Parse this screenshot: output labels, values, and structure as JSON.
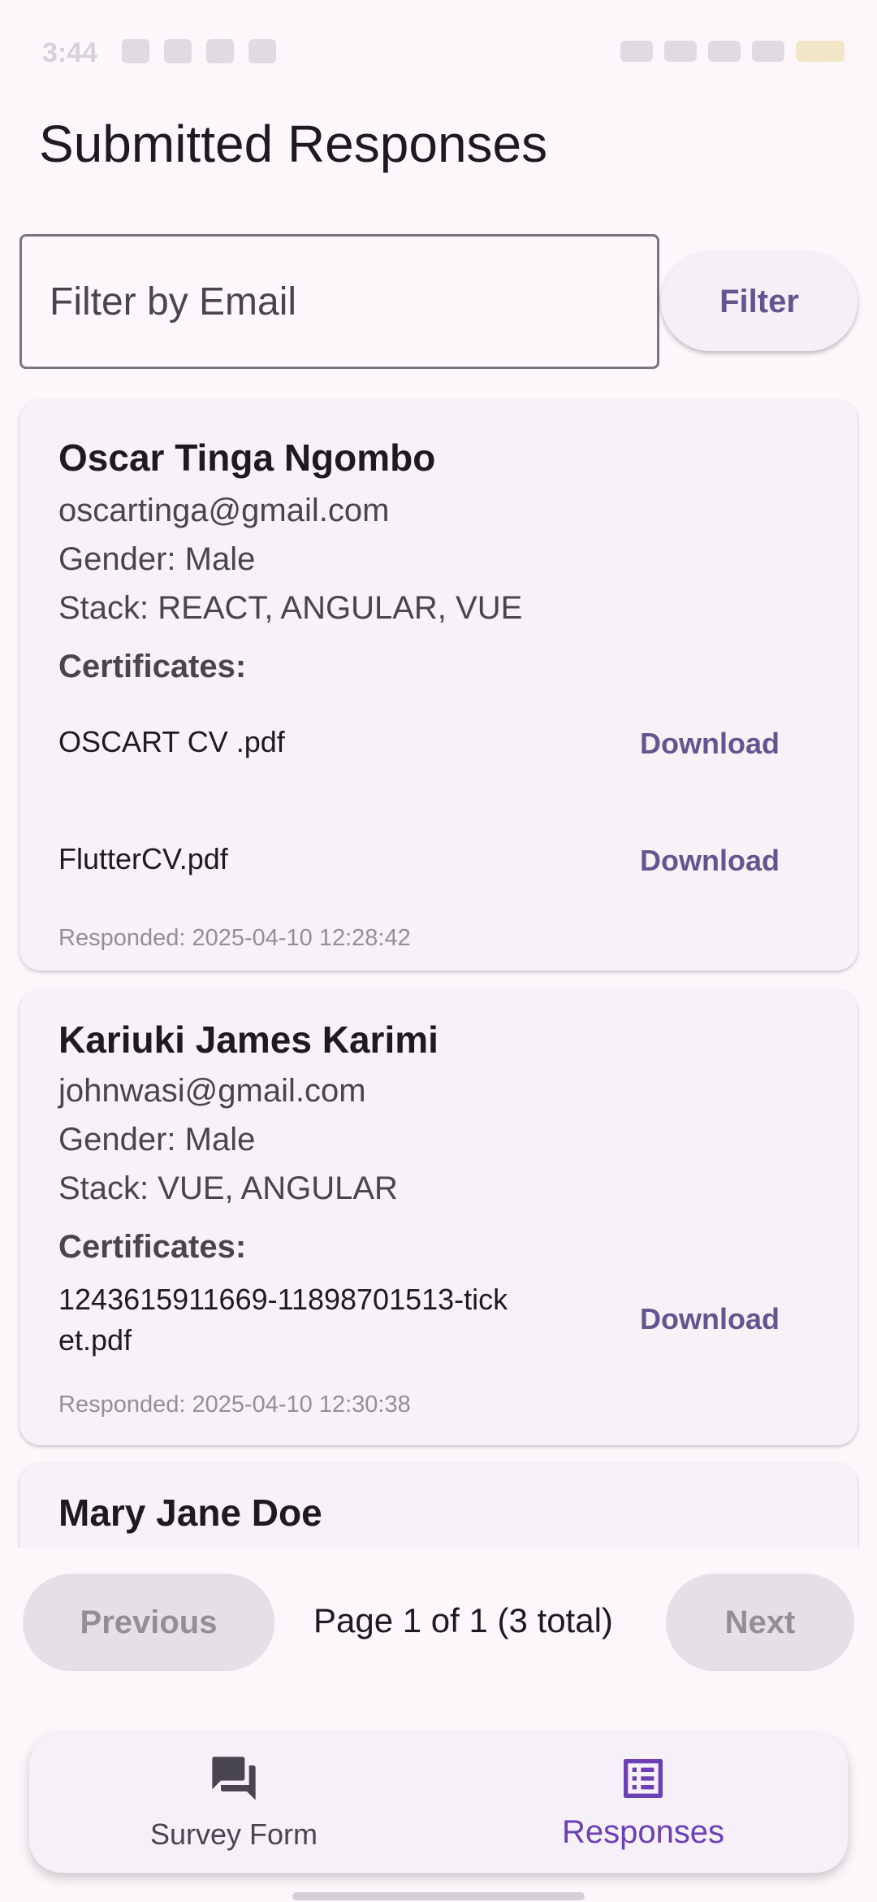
{
  "page": {
    "title": "Submitted Responses"
  },
  "status_bar": {
    "time": "3:44"
  },
  "filter": {
    "placeholder": "Filter by Email",
    "value": "",
    "button_label": "Filter"
  },
  "responses": [
    {
      "name": "Oscar Tinga Ngombo",
      "email": "oscartinga@gmail.com",
      "gender": "Gender: Male",
      "stack": "Stack: REACT, ANGULAR, VUE",
      "certificates_heading": "Certificates:",
      "certificates": [
        {
          "file": "OSCART CV .pdf",
          "action": "Download"
        },
        {
          "file": "FlutterCV.pdf",
          "action": "Download"
        }
      ],
      "responded": "Responded: 2025-04-10 12:28:42"
    },
    {
      "name": "Kariuki James Karimi",
      "email": "johnwasi@gmail.com",
      "gender": "Gender: Male",
      "stack": "Stack: VUE, ANGULAR",
      "certificates_heading": "Certificates:",
      "certificates": [
        {
          "file": "1243615911669-11898701513-ticket.pdf",
          "action": "Download"
        }
      ],
      "responded": "Responded: 2025-04-10 12:30:38"
    },
    {
      "name": "Mary Jane Doe"
    }
  ],
  "pagination": {
    "previous_label": "Previous",
    "info": "Page 1 of 1 (3 total)",
    "next_label": "Next"
  },
  "bottom_nav": {
    "items": [
      {
        "label": "Survey Form",
        "icon": "forum-icon",
        "selected": false
      },
      {
        "label": "Responses",
        "icon": "list-alt-icon",
        "selected": true
      }
    ]
  },
  "colors": {
    "accent": "#65558f",
    "selected_nav": "#6c3fb5",
    "background": "#fdf7fb",
    "card": "#f7f2f8"
  }
}
